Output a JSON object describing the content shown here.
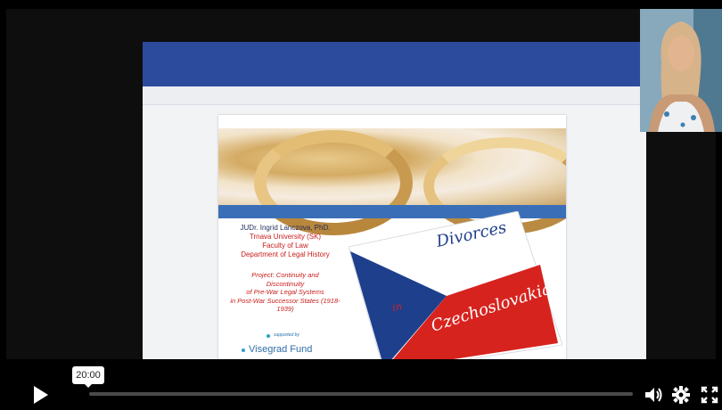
{
  "player": {
    "tooltip_time": "20:00",
    "progress": 0.0,
    "icons": {
      "play": "play-icon",
      "volume": "volume-icon",
      "settings": "gear-icon",
      "fullscreen": "fullscreen-icon"
    }
  },
  "slide": {
    "author_name": "JUDr. Ingrid Lanczova, PhD.",
    "affiliation": [
      "Trnava University (SK)",
      "Faculty of Law",
      "Department of Legal History"
    ],
    "project": [
      "Project: Continuity and",
      "Discontinuity",
      "of Pre-War Legal Systems",
      "in Post-War Successor States (1918-",
      "1939)"
    ],
    "supported_by": "supported by",
    "fund": "Visegrad Fund",
    "logo_title_1": "Divorces",
    "logo_title_2": "in",
    "logo_title_3": "Czechoslovakia"
  },
  "colors": {
    "czech_blue": "#1e3f8c",
    "czech_red": "#d7231e",
    "share_bar": "#2c4b9c"
  }
}
